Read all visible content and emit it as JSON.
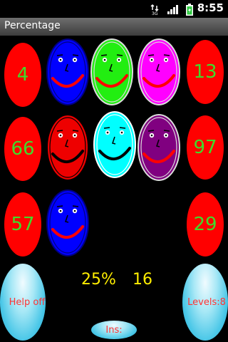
{
  "status_bar": {
    "time": "8:55",
    "network_label": "3G",
    "icons": [
      "data-transfer-icon",
      "signal-icon",
      "battery-charging-icon"
    ]
  },
  "app": {
    "title": "Percentage"
  },
  "numbers": {
    "r1_left": "4",
    "r1_right": "13",
    "r2_left": "66",
    "r2_right": "97",
    "r3_left": "57",
    "r3_right": "29"
  },
  "faces": [
    {
      "id": "face-blue-1",
      "color": "#0000ff",
      "outline": "#000080",
      "mouth": "#ff0000",
      "expression": "smile"
    },
    {
      "id": "face-green",
      "color": "#22ee11",
      "outline": "#dcdcdc",
      "mouth": "#ff0000",
      "expression": "smile"
    },
    {
      "id": "face-magenta",
      "color": "#ff00ff",
      "outline": "#dcdcdc",
      "mouth": "#ff0000",
      "expression": "smile"
    },
    {
      "id": "face-red",
      "color": "#ee0000",
      "outline": "#000000",
      "mouth": "#000000",
      "expression": "smile"
    },
    {
      "id": "face-cyan",
      "color": "#00ffff",
      "outline": "#ffffff",
      "mouth": "#000000",
      "expression": "smile"
    },
    {
      "id": "face-purple",
      "color": "#800080",
      "outline": "#dcdcdc",
      "mouth": "#ff0000",
      "expression": "smile"
    },
    {
      "id": "face-blue-2",
      "color": "#0000ff",
      "outline": "#000080",
      "mouth": "#ff0000",
      "expression": "smile"
    }
  ],
  "controls": {
    "help_label": "Help off",
    "levels_label": "Levels:8",
    "ins_label": "Ins:"
  },
  "score": {
    "percent": "25%",
    "value": "16"
  },
  "colors": {
    "number_oval": "#ff0000",
    "number_text": "#3fdc2a",
    "score_text": "#ffee00",
    "button_text": "#ff3333"
  }
}
